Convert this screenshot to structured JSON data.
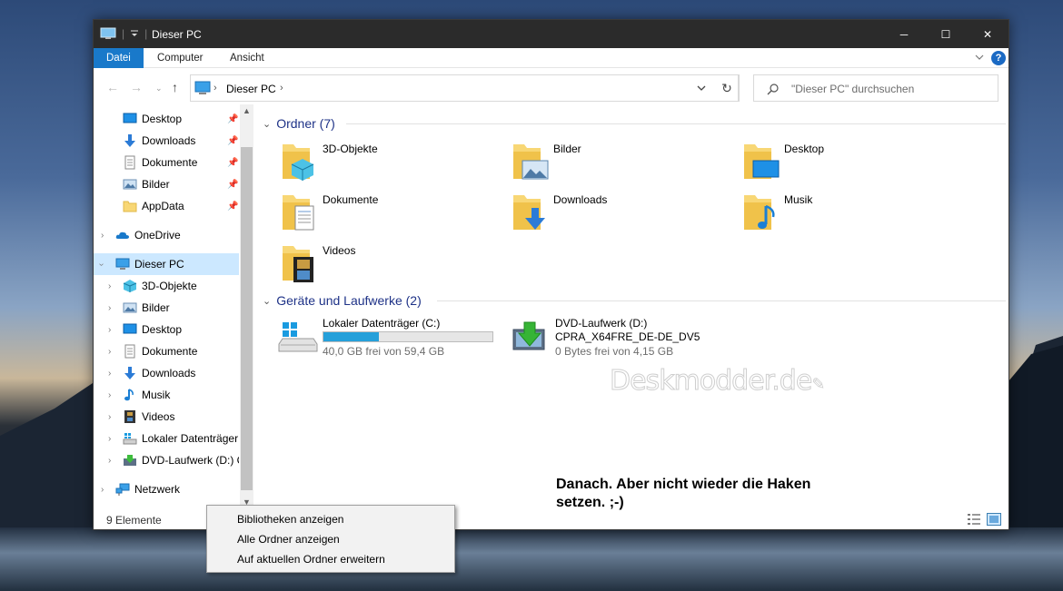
{
  "window": {
    "title": "Dieser PC",
    "minimize": "─",
    "maximize": "☐",
    "close": "✕"
  },
  "ribbon": {
    "tabs": [
      {
        "label": "Datei",
        "active": true
      },
      {
        "label": "Computer",
        "active": false
      },
      {
        "label": "Ansicht",
        "active": false
      }
    ],
    "help": "?"
  },
  "address": {
    "path": "Dieser PC",
    "search_placeholder": "\"Dieser PC\" durchsuchen"
  },
  "sidebar": {
    "quick_access": [
      {
        "label": "Desktop",
        "icon": "desktop-icon",
        "pinned": true
      },
      {
        "label": "Downloads",
        "icon": "download-icon",
        "pinned": true
      },
      {
        "label": "Dokumente",
        "icon": "documents-icon",
        "pinned": true
      },
      {
        "label": "Bilder",
        "icon": "pictures-icon",
        "pinned": true
      },
      {
        "label": "AppData",
        "icon": "folder-icon",
        "pinned": true
      }
    ],
    "onedrive": "OneDrive",
    "this_pc": "Dieser PC",
    "this_pc_children": [
      {
        "label": "3D-Objekte",
        "icon": "3d-objects-icon"
      },
      {
        "label": "Bilder",
        "icon": "pictures-icon"
      },
      {
        "label": "Desktop",
        "icon": "desktop-icon"
      },
      {
        "label": "Dokumente",
        "icon": "documents-icon"
      },
      {
        "label": "Downloads",
        "icon": "download-icon"
      },
      {
        "label": "Musik",
        "icon": "music-icon"
      },
      {
        "label": "Videos",
        "icon": "videos-icon"
      },
      {
        "label": "Lokaler Datenträger",
        "icon": "drive-icon"
      },
      {
        "label": "DVD-Laufwerk (D:) C",
        "icon": "dvd-icon"
      }
    ],
    "network": "Netzwerk"
  },
  "content": {
    "folders_header": "Ordner (7)",
    "folders": [
      {
        "label": "3D-Objekte",
        "overlay": "3d"
      },
      {
        "label": "Bilder",
        "overlay": "pictures"
      },
      {
        "label": "Desktop",
        "overlay": "desktop"
      },
      {
        "label": "Dokumente",
        "overlay": "documents"
      },
      {
        "label": "Downloads",
        "overlay": "downloads"
      },
      {
        "label": "Musik",
        "overlay": "music"
      },
      {
        "label": "Videos",
        "overlay": "videos"
      }
    ],
    "drives_header": "Geräte und Laufwerke (2)",
    "drives": [
      {
        "name": "Lokaler Datenträger (C:)",
        "free": "40,0 GB frei von 59,4 GB",
        "used_fraction": 0.33
      },
      {
        "name": "DVD-Laufwerk (D:)",
        "label": "CPRA_X64FRE_DE-DE_DV5",
        "free": "0 Bytes frei von 4,15 GB"
      }
    ]
  },
  "annotation": {
    "line1": "Danach. Aber nicht wieder die Haken",
    "line2": "setzen. ;-)"
  },
  "watermark": "Deskmodder.de",
  "status": {
    "count": "9 Elemente"
  },
  "context_menu": {
    "items": [
      "Bibliotheken anzeigen",
      "Alle Ordner anzeigen",
      "Auf aktuellen Ordner erweitern"
    ]
  },
  "colors": {
    "accent": "#1979ca",
    "selection": "#cce8ff",
    "group_header": "#1e3287",
    "drive_bar": "#26a0da"
  }
}
